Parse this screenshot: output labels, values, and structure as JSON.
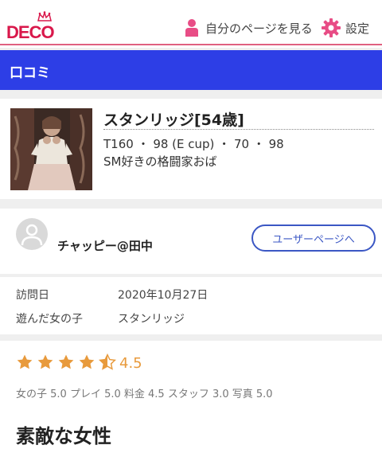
{
  "header": {
    "logo_text": "DECO",
    "mypage_label": "自分のページを見る",
    "settings_label": "設定"
  },
  "titlebar": {
    "title": "口コミ"
  },
  "girl": {
    "name": "スタンリッジ[54歳]",
    "specs": "T160 ・ 98 (E cup) ・ 70 ・ 98",
    "catchphrase": "SM好きの格闘家おば"
  },
  "user": {
    "name": "チャッピー@田中",
    "user_page_button": "ユーザーページへ"
  },
  "details": {
    "visit_label": "訪問日",
    "visit_value": "2020年10月27日",
    "girl_label": "遊んだ女の子",
    "girl_value": "スタンリッジ"
  },
  "rating": {
    "score": "4.5",
    "value": 4.5,
    "max": 5,
    "breakdown": "女の子 5.0 プレイ 5.0 料金 4.5 スタッフ 3.0 写真 5.0"
  },
  "review": {
    "title": "素敵な女性"
  },
  "colors": {
    "brand": "#d9184b",
    "titlebar": "#2d3ee6",
    "star": "#e89a3c",
    "button": "#3b57c4"
  }
}
